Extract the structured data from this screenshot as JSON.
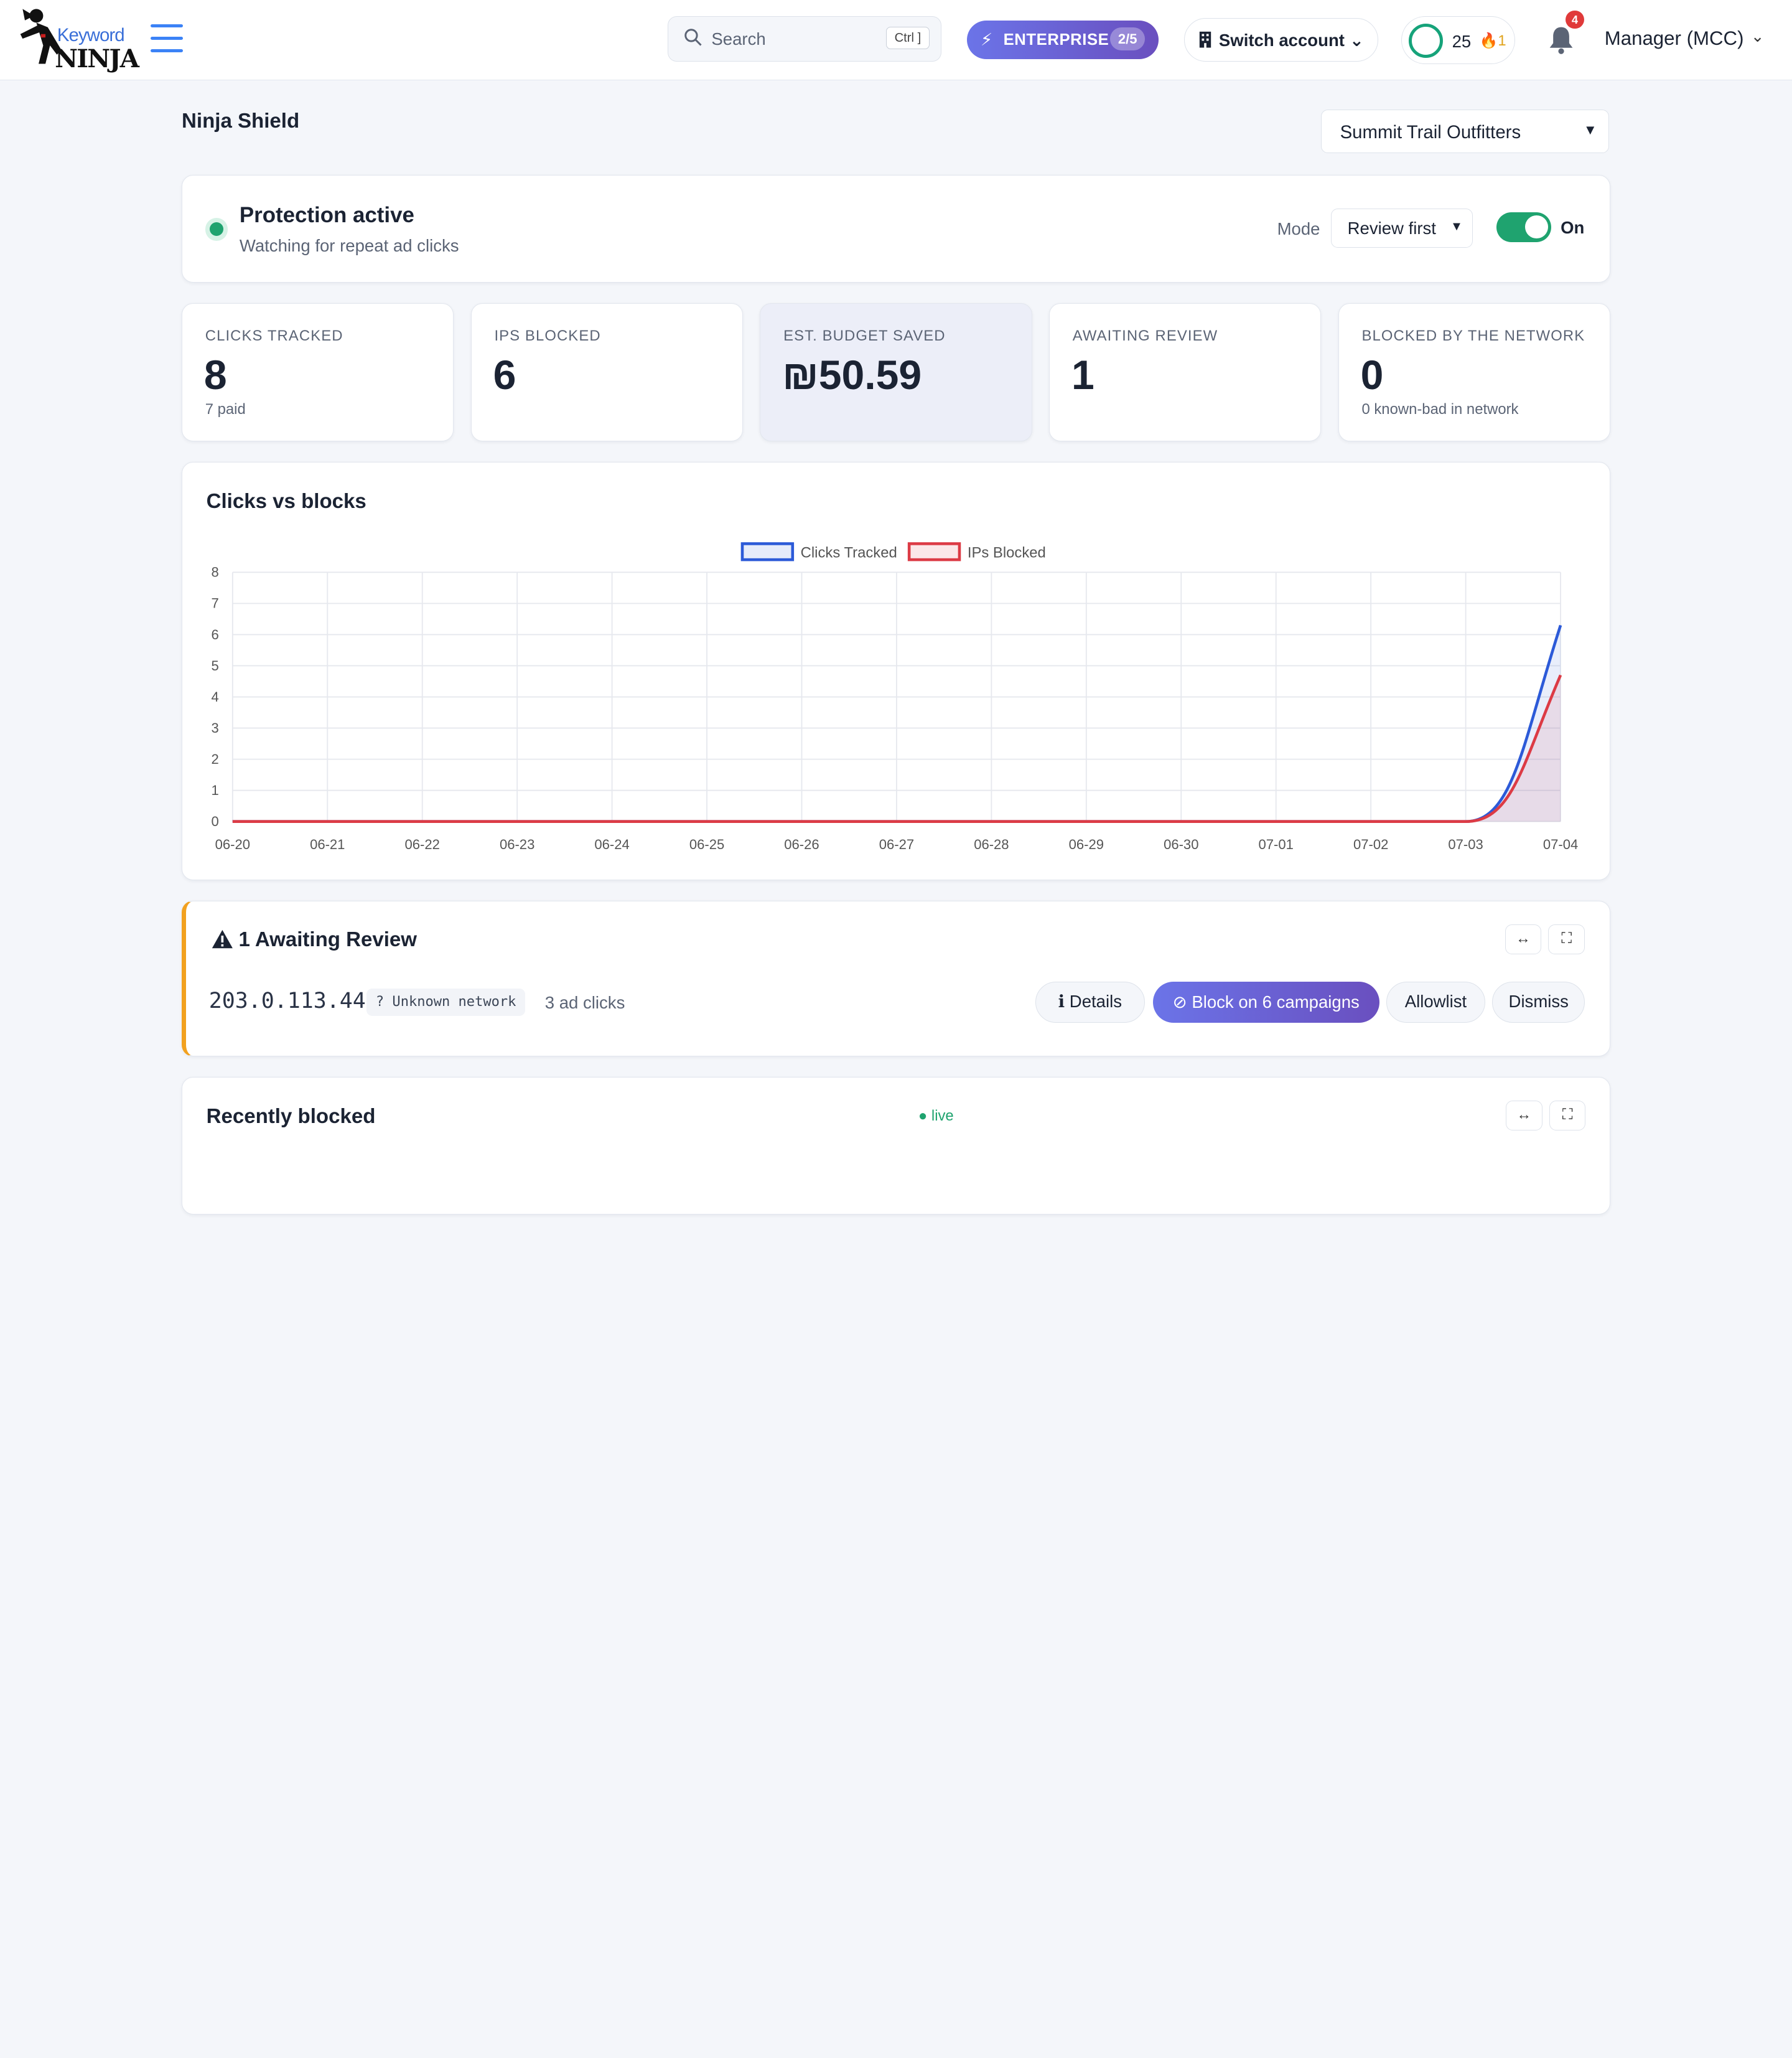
{
  "header": {
    "logo_top": "Keyword",
    "logo_bottom": "NINJA",
    "search_placeholder": "Search",
    "search_shortcut": "Ctrl ]",
    "plan_label": "ENTERPRISE",
    "plan_count": "2/5",
    "switch_account": "Switch account",
    "credits": "25",
    "streak": "1",
    "notifications": "4",
    "user": "Manager (MCC)"
  },
  "page": {
    "title": "Ninja Shield",
    "account_selected": "Summit Trail Outfitters"
  },
  "protection": {
    "title": "Protection active",
    "subtitle": "Watching for repeat ad clicks",
    "mode_label": "Mode",
    "mode_value": "Review first",
    "toggle_label": "On"
  },
  "stats": [
    {
      "label": "CLICKS TRACKED",
      "value": "8",
      "sub": "7 paid"
    },
    {
      "label": "IPS BLOCKED",
      "value": "6",
      "sub": ""
    },
    {
      "label": "EST. BUDGET SAVED",
      "value": "₪50.59",
      "sub": ""
    },
    {
      "label": "AWAITING REVIEW",
      "value": "1",
      "sub": ""
    },
    {
      "label": "BLOCKED BY THE NETWORK",
      "value": "0",
      "sub": "0 known-bad in network"
    }
  ],
  "chart_title": "Clicks vs blocks",
  "chart_data": {
    "type": "area",
    "title": "Clicks vs blocks",
    "legend_placement": "top-center",
    "grid": true,
    "x": [
      "06-20",
      "06-21",
      "06-22",
      "06-23",
      "06-24",
      "06-25",
      "06-26",
      "06-27",
      "06-28",
      "06-29",
      "06-30",
      "07-01",
      "07-02",
      "07-03",
      "07-04"
    ],
    "ylim": [
      0,
      8
    ],
    "yticks": [
      0,
      1,
      2,
      3,
      4,
      5,
      6,
      7,
      8
    ],
    "series": [
      {
        "name": "Clicks Tracked",
        "color": "#2c5ad8",
        "values": [
          0,
          0,
          0,
          0,
          0,
          0,
          0,
          0,
          0,
          0,
          0,
          0,
          0,
          0,
          6.3
        ]
      },
      {
        "name": "IPs Blocked",
        "color": "#dc3b45",
        "values": [
          0,
          0,
          0,
          0,
          0,
          0,
          0,
          0,
          0,
          0,
          0,
          0,
          0,
          0,
          4.7
        ]
      }
    ]
  },
  "review": {
    "title": "1 Awaiting Review",
    "ip": "203.0.113.44",
    "network": "? Unknown network",
    "clicks": "3 ad clicks",
    "details": "Details",
    "block": "Block on 6 campaigns",
    "allowlist": "Allowlist",
    "dismiss": "Dismiss"
  },
  "recent": {
    "title": "Recently blocked",
    "live": "● live"
  },
  "colors": {
    "accent": "#3b82f6",
    "success": "#1fa36f",
    "warning": "#f2a11f",
    "brand_gradient_start": "#6b74e8",
    "brand_gradient_end": "#6a4fbf"
  }
}
